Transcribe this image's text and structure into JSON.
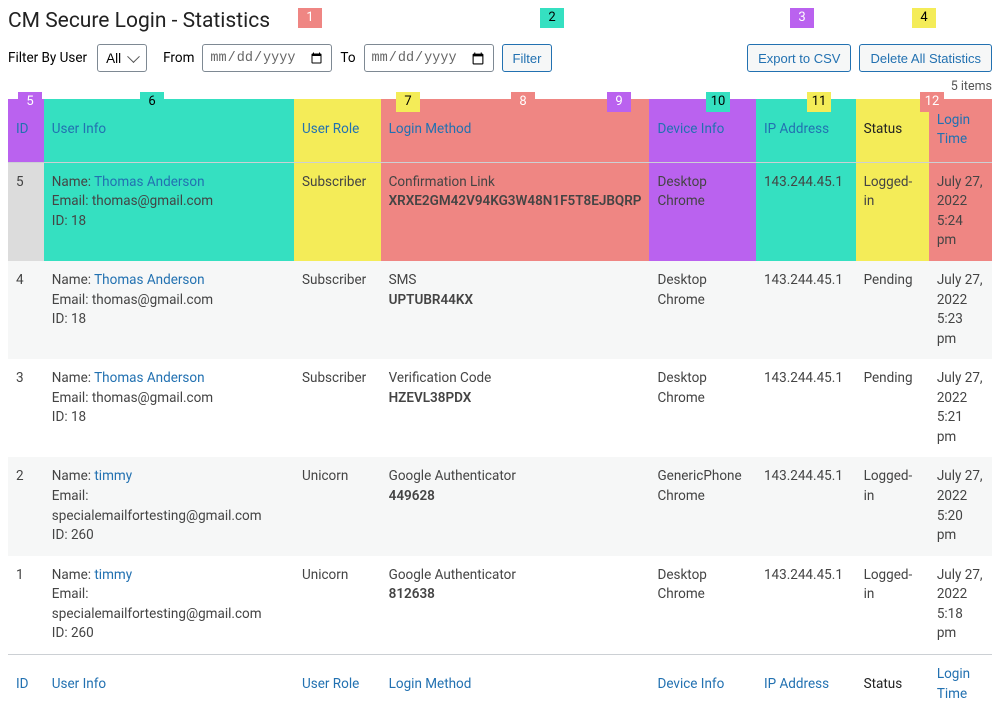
{
  "page": {
    "title": "CM Secure Login - Statistics",
    "items_count": "5 items"
  },
  "filters": {
    "user_label": "Filter By User",
    "user_value": "All",
    "from_label": "From",
    "to_label": "To",
    "date_placeholder": "mm/dd/yyyy",
    "filter_btn": "Filter",
    "export_btn": "Export to CSV",
    "delete_btn": "Delete All Statistics"
  },
  "columns": {
    "id": "ID",
    "user": "User Info",
    "role": "User Role",
    "login": "Login Method",
    "device": "Device Info",
    "ip": "IP Address",
    "status": "Status",
    "time": "Login Time"
  },
  "rows": [
    {
      "id": "5",
      "name": "Thomas Anderson",
      "email": "thomas@gmail.com",
      "uid": "18",
      "role": "Subscriber",
      "login_label": "Confirmation Link",
      "login_code": "XRXE2GM42V94KG3W48N1F5T8EJBQRP",
      "device": "Desktop Chrome",
      "ip": "143.244.45.1",
      "status": "Logged-in",
      "time_date": "July 27, 2022",
      "time_clock": "5:24 pm"
    },
    {
      "id": "4",
      "name": "Thomas Anderson",
      "email": "thomas@gmail.com",
      "uid": "18",
      "role": "Subscriber",
      "login_label": "SMS",
      "login_code": "UPTUBR44KX",
      "device": "Desktop Chrome",
      "ip": "143.244.45.1",
      "status": "Pending",
      "time_date": "July 27, 2022",
      "time_clock": "5:23 pm"
    },
    {
      "id": "3",
      "name": "Thomas Anderson",
      "email": "thomas@gmail.com",
      "uid": "18",
      "role": "Subscriber",
      "login_label": "Verification Code",
      "login_code": "HZEVL38PDX",
      "device": "Desktop Chrome",
      "ip": "143.244.45.1",
      "status": "Pending",
      "time_date": "July 27, 2022",
      "time_clock": "5:21 pm"
    },
    {
      "id": "2",
      "name": "timmy",
      "email": "specialemailfortesting@gmail.com",
      "uid": "260",
      "role": "Unicorn",
      "login_label": "Google Authenticator",
      "login_code": "449628",
      "device": "GenericPhone Chrome",
      "ip": "143.244.45.1",
      "status": "Logged-in",
      "time_date": "July 27, 2022",
      "time_clock": "5:20 pm"
    },
    {
      "id": "1",
      "name": "timmy",
      "email": "specialemailfortesting@gmail.com",
      "uid": "260",
      "role": "Unicorn",
      "login_label": "Google Authenticator",
      "login_code": "812638",
      "device": "Desktop Chrome",
      "ip": "143.244.45.1",
      "status": "Logged-in",
      "time_date": "July 27, 2022",
      "time_clock": "5:18 pm"
    }
  ],
  "badges": [
    "1",
    "2",
    "3",
    "4",
    "5",
    "6",
    "7",
    "8",
    "9",
    "10",
    "11",
    "12"
  ],
  "labels": {
    "nameprefix": "Name: ",
    "emailprefix": "Email: ",
    "idprefix": "ID: "
  }
}
